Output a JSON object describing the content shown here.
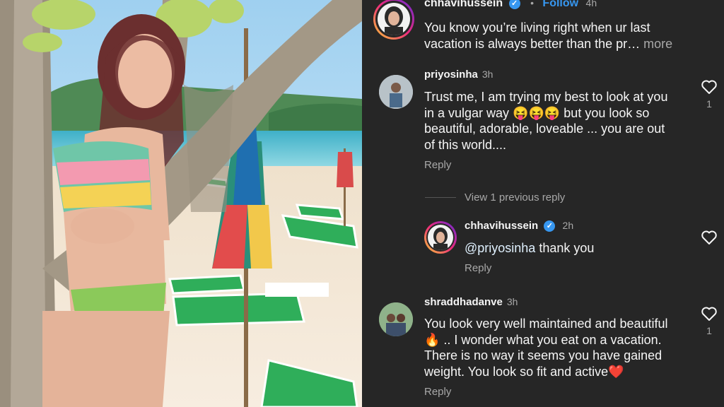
{
  "post": {
    "username": "chhavihussein",
    "dot": "•",
    "follow_label": "Follow",
    "time": "4h",
    "caption": "You know you’re living right when ur last vacation is always better than the pr…",
    "more_label": " more"
  },
  "comments": [
    {
      "username": "priyosinha",
      "time": "3h",
      "text_lines": [
        "Trust me, I am trying my best to look at you",
        "in a vulgar way 😝😝😝 but you look so",
        "beautiful, adorable, loveable ... you are out",
        "of this world...."
      ],
      "reply_label": "Reply",
      "likes": "1"
    },
    {
      "username": "shraddhadanve",
      "time": "3h",
      "text_lines": [
        "You look very well maintained and beautiful",
        "🔥 .. I wonder what you eat on a vacation.",
        "There is no way it seems you have gained",
        "weight. You look so fit and active❤️"
      ],
      "reply_label": "Reply",
      "likes": "1"
    }
  ],
  "view_replies_label": "View 1 previous reply",
  "nested_reply": {
    "username": "chhavihussein",
    "time": "2h",
    "mention": "@priyosinha",
    "text": " thank you",
    "reply_label": "Reply"
  },
  "colors": {
    "background": "#262626",
    "text": "#f5f5f5",
    "muted": "#a8a8a8",
    "link": "#3797f0",
    "verified": "#3797f0"
  }
}
